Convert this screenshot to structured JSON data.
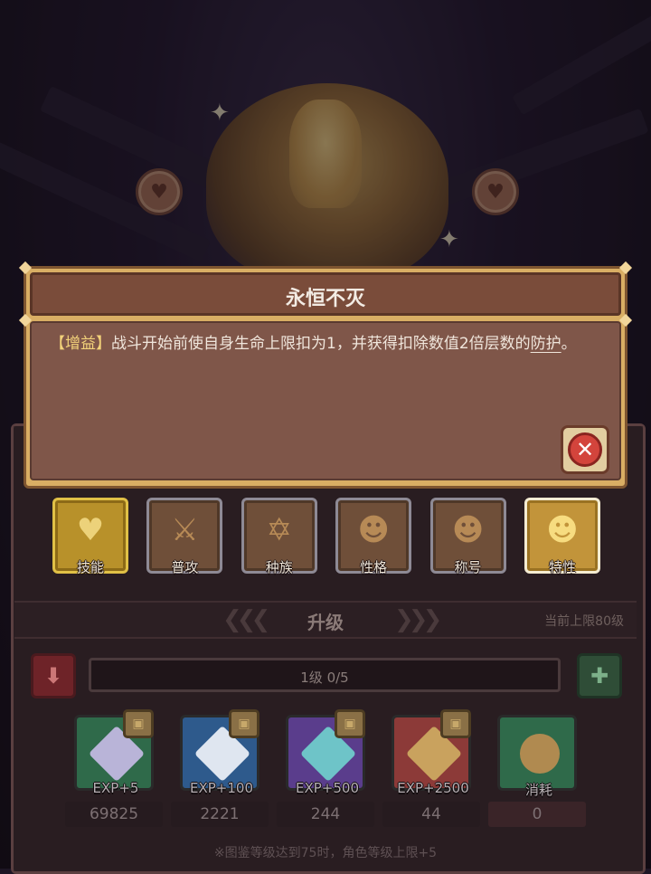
{
  "dialog": {
    "title": "永恒不灭",
    "tag": "【增益】",
    "text_part1": "战斗开始前使自身生命上限扣为1，并获得扣除数值2倍层数的",
    "keyword": "防护",
    "text_end": "。",
    "close_icon": "close-x"
  },
  "tabs": [
    {
      "label": "技能",
      "icon": "heart-plus-icon"
    },
    {
      "label": "普攻",
      "icon": "sword-icon"
    },
    {
      "label": "种族",
      "icon": "hexagram-icon"
    },
    {
      "label": "性格",
      "icon": "character-icon"
    },
    {
      "label": "称号",
      "icon": "character-icon"
    },
    {
      "label": "特性",
      "icon": "character-icon",
      "active": true
    }
  ],
  "upgrade": {
    "title": "升级",
    "cap": "当前上限80级",
    "level_text": "1级  0/5",
    "progress": 0.0
  },
  "items": [
    {
      "caption": "EXP+5",
      "count": "69825",
      "color": "#2f6a4a"
    },
    {
      "caption": "EXP+100",
      "count": "2221",
      "color": "#2e5a8c"
    },
    {
      "caption": "EXP+500",
      "count": "244",
      "color": "#5a3d8c"
    },
    {
      "caption": "EXP+2500",
      "count": "44",
      "color": "#8c3a38"
    },
    {
      "caption": "消耗",
      "count": "0",
      "color": "#2f6a4a"
    }
  ],
  "footer_note": "※图鉴等级达到75时，角色等级上限+5"
}
